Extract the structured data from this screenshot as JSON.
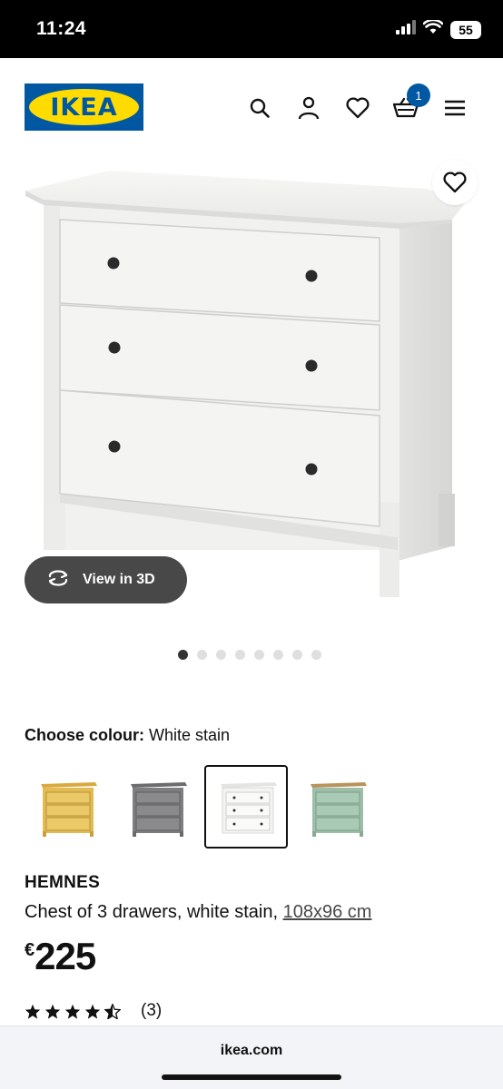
{
  "status_bar": {
    "time": "11:24",
    "battery": "55",
    "icons": [
      "signal-icon",
      "wifi-icon",
      "battery-icon"
    ]
  },
  "header": {
    "logo_text": "IKEA",
    "icons": [
      "search-icon",
      "account-icon",
      "favourites-icon",
      "cart-icon",
      "menu-icon"
    ],
    "cart_count": "1"
  },
  "gallery": {
    "view_3d_label": "View in 3D",
    "dot_count": 8,
    "active_dot": 1
  },
  "colour": {
    "label": "Choose colour:",
    "selected": "White stain",
    "swatches": [
      {
        "name": "yellow",
        "color": "#e2bc52"
      },
      {
        "name": "grey",
        "color": "#7e7e80"
      },
      {
        "name": "white-stain",
        "color": "#f4f4f2"
      },
      {
        "name": "light-green",
        "color": "#9dbfa9"
      }
    ]
  },
  "product": {
    "name": "HEMNES",
    "description": "Chest of 3 drawers, white stain, ",
    "size_link": "108x96 cm",
    "currency": "€",
    "price": "225",
    "rating_stars": 4.5,
    "review_count": "(3)"
  },
  "browser": {
    "url": "ikea.com"
  },
  "colors": {
    "ikea_blue": "#0058a3",
    "ikea_yellow": "#ffdb00",
    "button_dark": "#484848"
  }
}
